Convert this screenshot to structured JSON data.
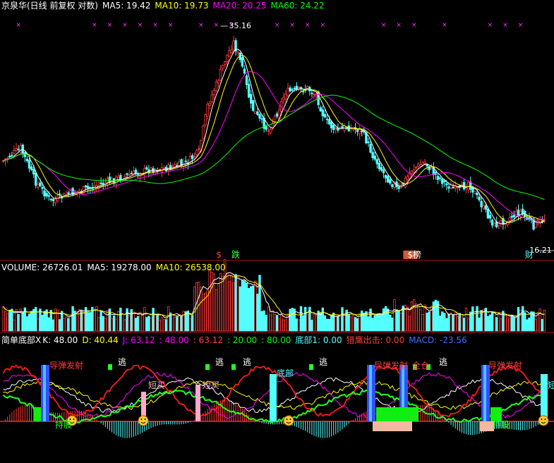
{
  "header": {
    "stock_label": "京泉华(日线 前复权 对数)",
    "ma5": "MA5: 19.42",
    "ma10": "MA10: 19.73",
    "ma20": "MA20: 20.25",
    "ma60": "MA60: 24.22"
  },
  "volume_header": {
    "label": "VOLUME: 26726.01",
    "ma5": "MA5: 19278.00",
    "ma10": "MA10: 26538.00"
  },
  "indicator_header": {
    "name": "简单底部X",
    "k": "K: 48.00",
    "d": "D: 40.44",
    "j": "J: 63.12",
    "v1": ": 48.00",
    "v2": ": 63.12",
    "v3": ": 20.00",
    "v4": ": 80.00",
    "bottom": "底部1: 0.00",
    "escape": "猎鹰出击: 0.00",
    "macd": "MACD: -23.56"
  },
  "colors": {
    "up": "#ff3b3b",
    "down": "#54ffff",
    "ma5": "#ffffff",
    "ma10": "#ffff00",
    "ma20": "#ff00ff",
    "ma60": "#00ff00",
    "grid": "#b01010"
  },
  "chart_data": [
    {
      "type": "candlestick",
      "title": "京泉华(日线 前复权 对数)",
      "price_annotations": [
        {
          "text": "35.16",
          "x": 100
        },
        {
          "text": "16.21",
          "x": 246
        }
      ],
      "event_labels": [
        {
          "text": "$",
          "x": 98
        },
        {
          "text": "跌",
          "x": 105
        },
        {
          "text": "$榜",
          "x": 186
        },
        {
          "text": "财",
          "x": 240
        }
      ]
    },
    {
      "type": "bar",
      "title": "VOLUME",
      "series": [
        {
          "name": "VOLUME",
          "last": 26726.01
        },
        {
          "name": "MA5",
          "last": 19278.0
        },
        {
          "name": "MA10",
          "last": 26538.0
        }
      ]
    },
    {
      "type": "line",
      "title": "简单底部X",
      "series": [
        {
          "name": "K",
          "last": 48.0
        },
        {
          "name": "D",
          "last": 40.44
        },
        {
          "name": "J",
          "last": 63.12
        }
      ],
      "levels": [
        20,
        80
      ],
      "signals": {
        "missile": "导弹发射",
        "escape": "逃",
        "short_buy": "短买",
        "bottom": "底部",
        "hold": "持股",
        "full_position": "全仓",
        "short_prefix": "短"
      }
    }
  ]
}
